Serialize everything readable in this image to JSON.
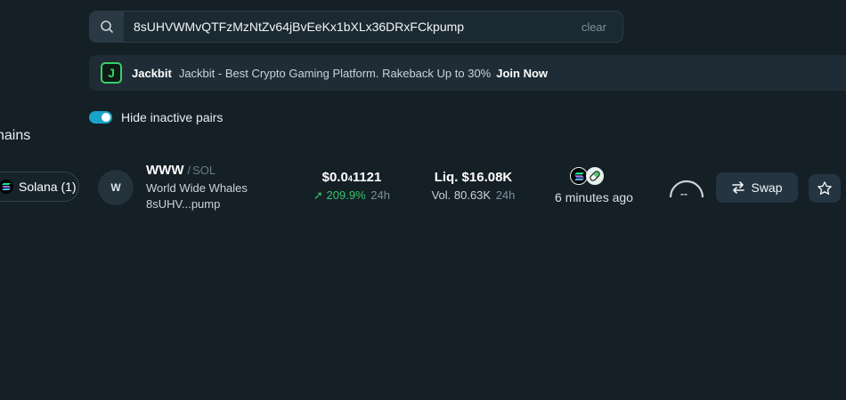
{
  "search": {
    "value": "8sUHVWMvQTFzMzNtZv64jBvEeKx1bXLx36DRxFCkpump",
    "clear_label": "clear",
    "icon": "search-icon"
  },
  "ad": {
    "logo_letter": "J",
    "name": "Jackbit",
    "text": "Jackbit - Best Crypto Gaming Platform. Rakeback Up to 30%",
    "cta": "Join Now"
  },
  "filters": {
    "hide_inactive_label": "Hide inactive pairs",
    "hide_inactive_on": true
  },
  "chains": {
    "title": "hains",
    "chip_label": "Solana (1)"
  },
  "pair": {
    "avatar_letter": "W",
    "symbol": "WWW",
    "separator": "/",
    "quote": "SOL",
    "name": "World Wide Whales",
    "address": "8sUHV...pump",
    "price_main": "$0.0",
    "price_sub": "4",
    "price_tail": "1121",
    "change_arrow": "➚",
    "change_value": "209.9%",
    "change_period": "24h",
    "liquidity": "Liq. $16.08K",
    "volume": "Vol. 80.63K",
    "volume_period": "24h",
    "age": "6 minutes ago",
    "gauge_value": "--",
    "swap_label": "Swap"
  },
  "colors": {
    "background": "#141f26",
    "accent_toggle": "#1aa3c7",
    "positive": "#34c36a",
    "ad_brand": "#35d16e"
  }
}
